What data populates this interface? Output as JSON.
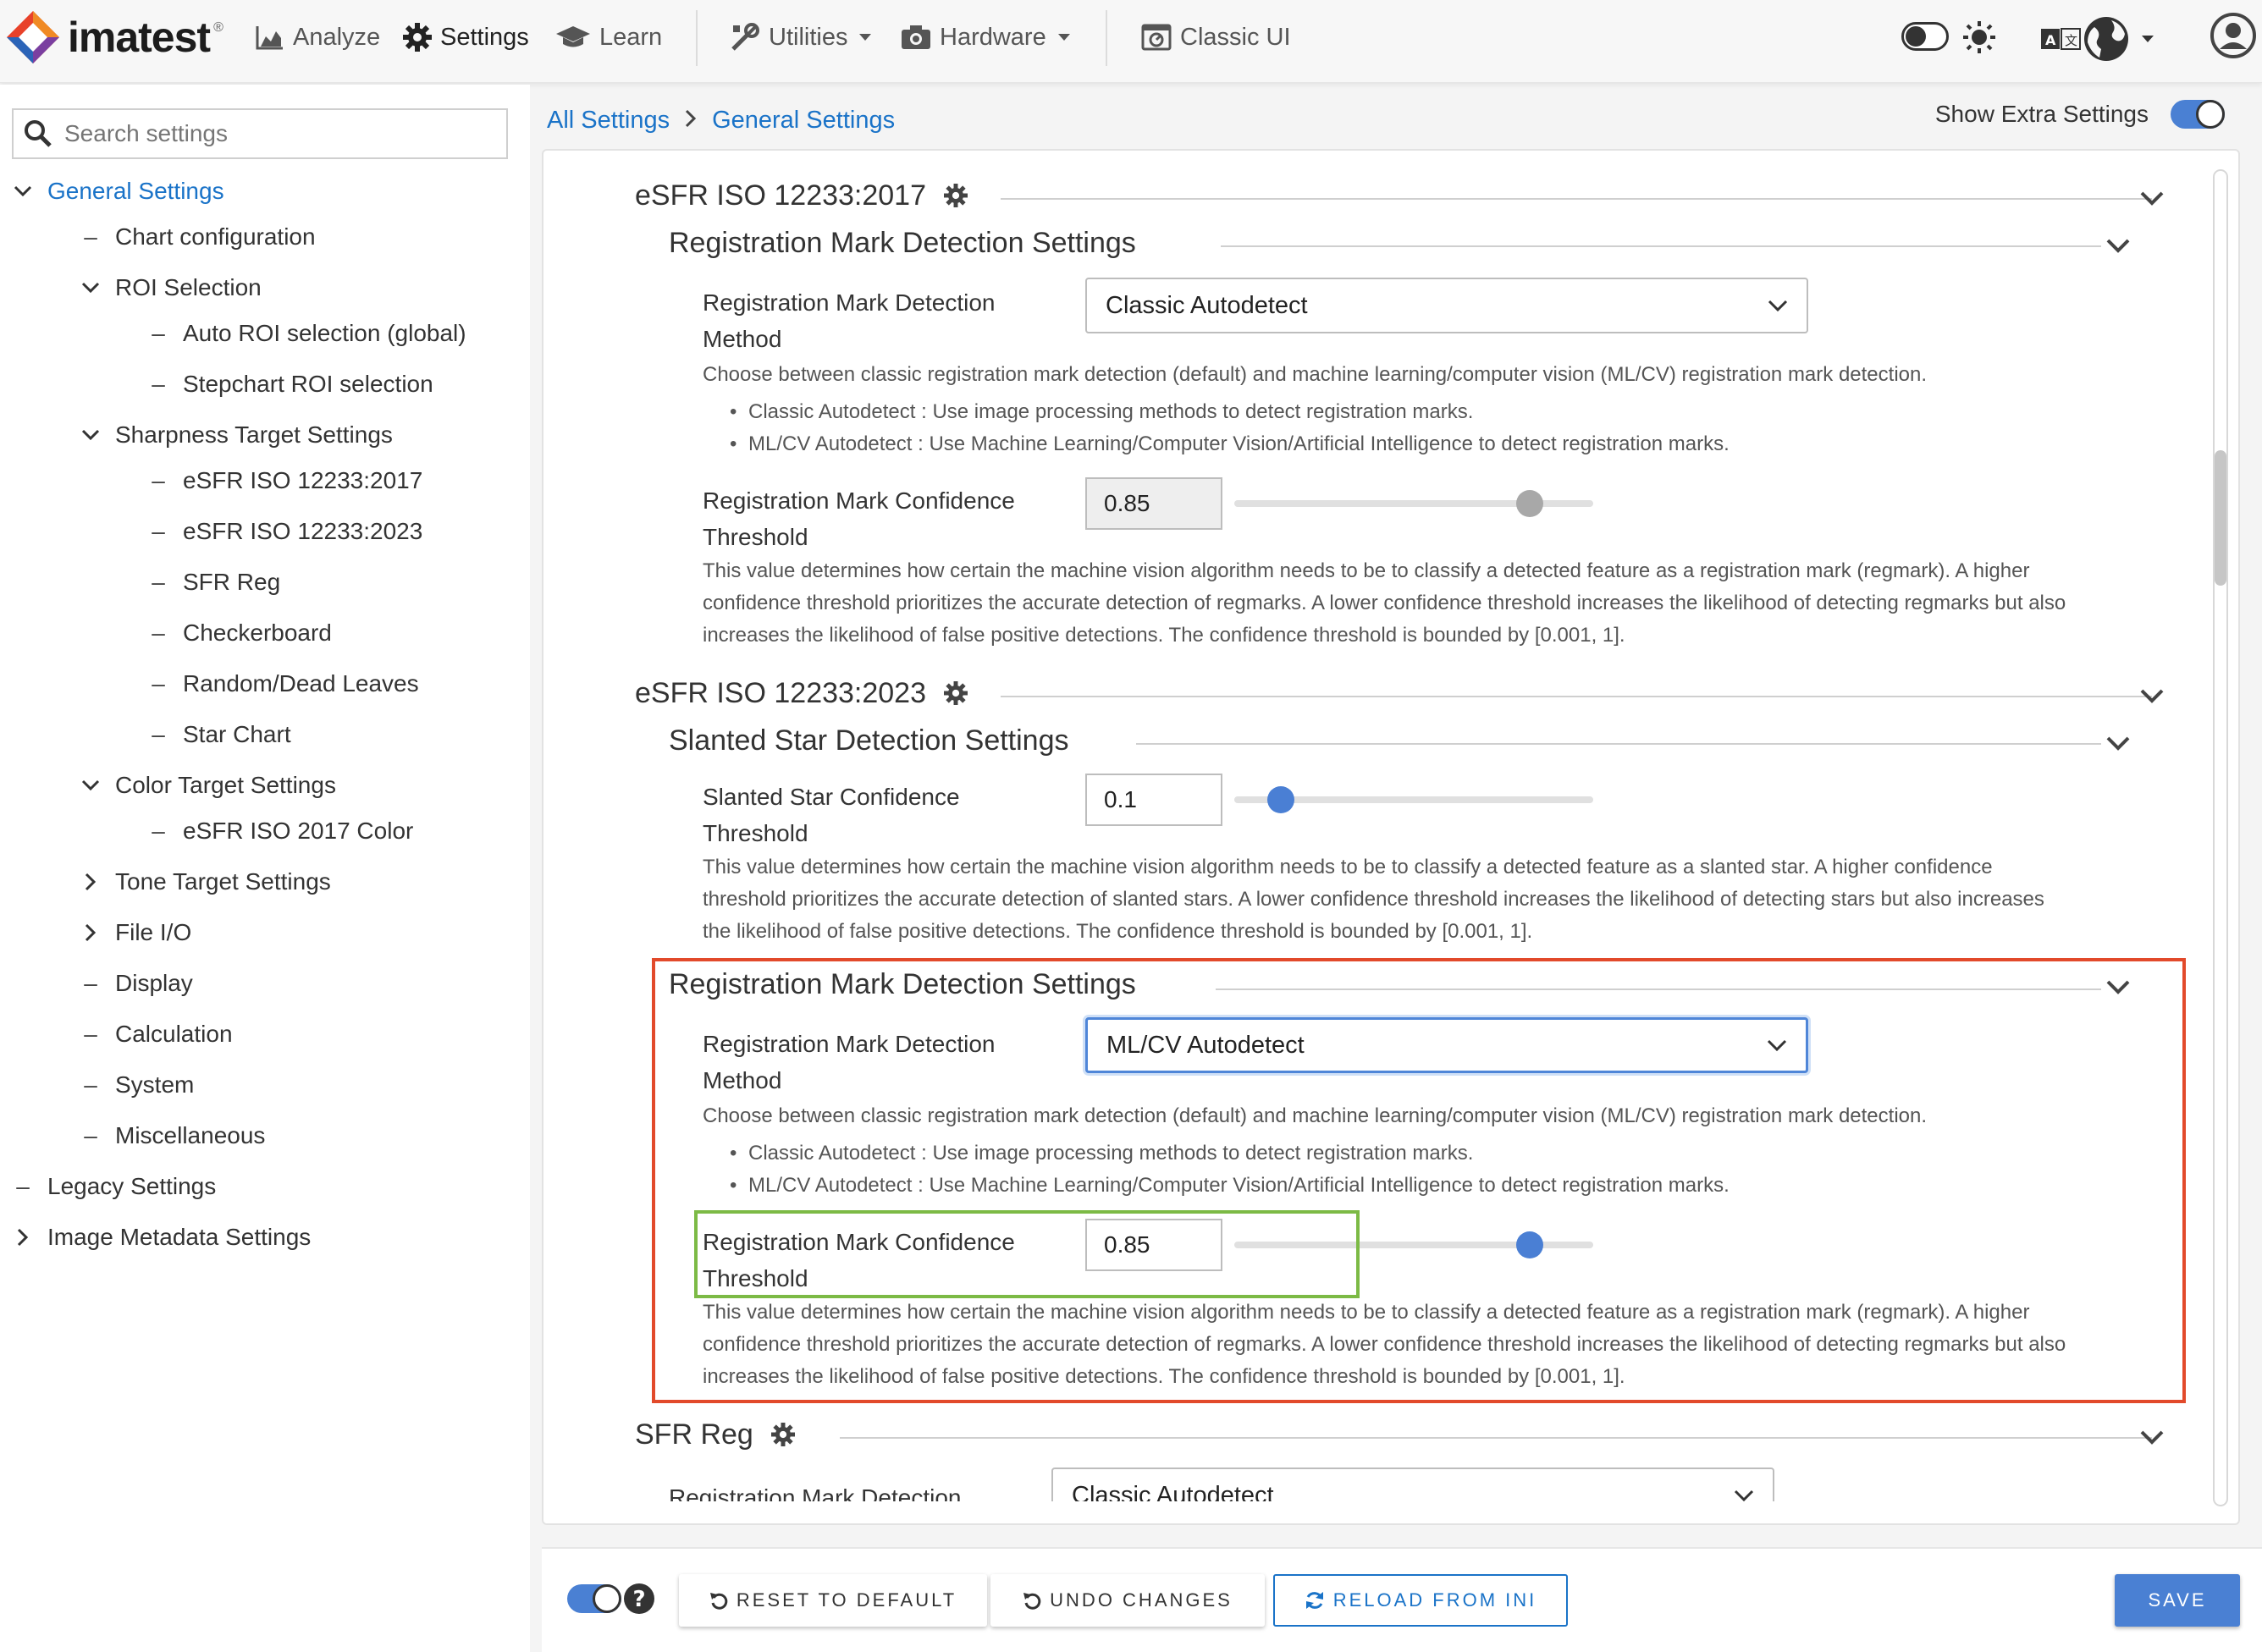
{
  "app": {
    "logo": "imatest",
    "logo_mark": "®"
  },
  "topnav": {
    "analyze": "Analyze",
    "settings": "Settings",
    "learn": "Learn",
    "utilities": "Utilities",
    "hardware": "Hardware",
    "classic_ui": "Classic UI"
  },
  "sidebar": {
    "search_placeholder": "Search settings",
    "items": [
      {
        "label": "General Settings"
      },
      {
        "label": "Chart configuration"
      },
      {
        "label": "ROI Selection"
      },
      {
        "label": "Auto ROI selection (global)"
      },
      {
        "label": "Stepchart ROI selection"
      },
      {
        "label": "Sharpness Target Settings"
      },
      {
        "label": "eSFR ISO 12233:2017"
      },
      {
        "label": "eSFR ISO 12233:2023"
      },
      {
        "label": "SFR Reg"
      },
      {
        "label": "Checkerboard"
      },
      {
        "label": "Random/Dead Leaves"
      },
      {
        "label": "Star Chart"
      },
      {
        "label": "Color Target Settings"
      },
      {
        "label": "eSFR ISO 2017 Color"
      },
      {
        "label": "Tone Target Settings"
      },
      {
        "label": "File I/O"
      },
      {
        "label": "Display"
      },
      {
        "label": "Calculation"
      },
      {
        "label": "System"
      },
      {
        "label": "Miscellaneous"
      },
      {
        "label": "Legacy Settings"
      },
      {
        "label": "Image Metadata Settings"
      }
    ]
  },
  "breadcrumb": {
    "all": "All Settings",
    "current": "General Settings"
  },
  "show_extra": {
    "label": "Show Extra Settings",
    "enabled": true
  },
  "sections": {
    "s2017": {
      "title": "eSFR ISO 12233:2017",
      "reg": {
        "title": "Registration Mark Detection Settings",
        "method_label": "Registration Mark Detection Method",
        "method_value": "Classic Autodetect",
        "method_desc": "Choose between classic registration mark detection (default) and machine learning/computer vision (ML/CV) registration mark detection.",
        "bullet_classic": "Classic Autodetect : Use image processing methods to detect registration marks.",
        "bullet_mlcv": "ML/CV Autodetect : Use Machine Learning/Computer Vision/Artificial Intelligence to detect registration marks.",
        "conf_label": "Registration Mark Confidence Threshold",
        "conf_value": "0.85",
        "conf_slider": 0.85,
        "conf_desc": "This value determines how certain the machine vision algorithm needs to be to classify a detected feature as a registration mark (regmark). A higher confidence threshold prioritizes the accurate detection of regmarks. A lower confidence threshold increases the likelihood of detecting regmarks but also increases the likelihood of false positive detections. The confidence threshold is bounded by [0.001, 1]."
      }
    },
    "s2023": {
      "title": "eSFR ISO 12233:2023",
      "star": {
        "title": "Slanted Star Detection Settings",
        "conf_label": "Slanted Star Confidence Threshold",
        "conf_value": "0.1",
        "conf_slider": 0.1,
        "conf_desc": "This value determines how certain the machine vision algorithm needs to be to classify a detected feature as a slanted star. A higher confidence threshold prioritizes the accurate detection of slanted stars. A lower confidence threshold increases the likelihood of detecting stars but also increases the likelihood of false positive detections. The confidence threshold is bounded by [0.001, 1]."
      },
      "reg": {
        "title": "Registration Mark Detection Settings",
        "method_label": "Registration Mark Detection Method",
        "method_value": "ML/CV Autodetect",
        "method_desc": "Choose between classic registration mark detection (default) and machine learning/computer vision (ML/CV) registration mark detection.",
        "bullet_classic": "Classic Autodetect : Use image processing methods to detect registration marks.",
        "bullet_mlcv": "ML/CV Autodetect : Use Machine Learning/Computer Vision/Artificial Intelligence to detect registration marks.",
        "conf_label": "Registration Mark Confidence Threshold",
        "conf_value": "0.85",
        "conf_slider": 0.85,
        "conf_desc": "This value determines how certain the machine vision algorithm needs to be to classify a detected feature as a registration mark (regmark). A higher confidence threshold prioritizes the accurate detection of regmarks. A lower confidence threshold increases the likelihood of detecting regmarks but also increases the likelihood of false positive detections. The confidence threshold is bounded by [0.001, 1]."
      }
    },
    "sfrreg": {
      "title": "SFR Reg",
      "method_label": "Registration Mark Detection",
      "method_value": "Classic Autodetect"
    }
  },
  "footer": {
    "reset": "RESET TO DEFAULT",
    "undo": "UNDO CHANGES",
    "reload": "RELOAD FROM INI",
    "save": "SAVE"
  },
  "colors": {
    "accent": "#1a73c8",
    "slider_active": "#4a7fd4",
    "slider_disabled": "#a8a8a8",
    "highlight_red": "#e24a2b",
    "highlight_green": "#7cba45"
  }
}
